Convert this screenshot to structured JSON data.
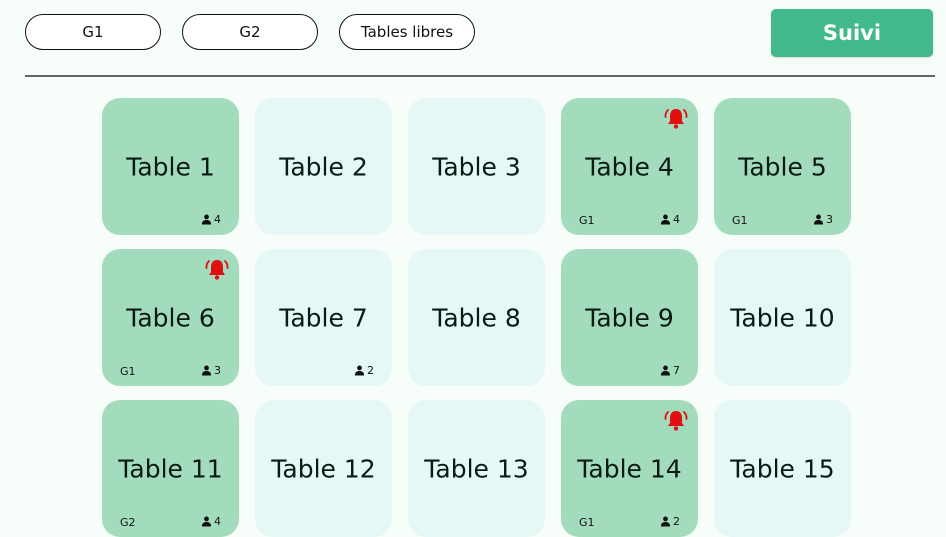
{
  "filters": [
    "G1",
    "G2",
    "Tables libres"
  ],
  "header": {
    "suivi_label": "Suivi"
  },
  "colors": {
    "occupied": "#a3dcbc",
    "free": "#e5f8f5",
    "accent": "#42b98a",
    "alert": "#e01010"
  },
  "tables": [
    {
      "name": "Table 1",
      "status": "occupied",
      "group": "",
      "guests": "4",
      "alert": false
    },
    {
      "name": "Table 2",
      "status": "free",
      "group": "",
      "guests": "",
      "alert": false
    },
    {
      "name": "Table 3",
      "status": "free",
      "group": "",
      "guests": "",
      "alert": false
    },
    {
      "name": "Table 4",
      "status": "occupied",
      "group": "G1",
      "guests": "4",
      "alert": true
    },
    {
      "name": "Table 5",
      "status": "occupied",
      "group": "G1",
      "guests": "3",
      "alert": false
    },
    {
      "name": "Table 6",
      "status": "occupied",
      "group": "G1",
      "guests": "3",
      "alert": true
    },
    {
      "name": "Table 7",
      "status": "free",
      "group": "",
      "guests": "2",
      "alert": false
    },
    {
      "name": "Table 8",
      "status": "free",
      "group": "",
      "guests": "",
      "alert": false
    },
    {
      "name": "Table 9",
      "status": "occupied",
      "group": "",
      "guests": "7",
      "alert": false
    },
    {
      "name": "Table 10",
      "status": "free",
      "group": "",
      "guests": "",
      "alert": false
    },
    {
      "name": "Table 11",
      "status": "occupied",
      "group": "G2",
      "guests": "4",
      "alert": false
    },
    {
      "name": "Table 12",
      "status": "free",
      "group": "",
      "guests": "",
      "alert": false
    },
    {
      "name": "Table 13",
      "status": "free",
      "group": "",
      "guests": "",
      "alert": false
    },
    {
      "name": "Table 14",
      "status": "occupied",
      "group": "G1",
      "guests": "2",
      "alert": true
    },
    {
      "name": "Table 15",
      "status": "free",
      "group": "",
      "guests": "",
      "alert": false
    }
  ]
}
